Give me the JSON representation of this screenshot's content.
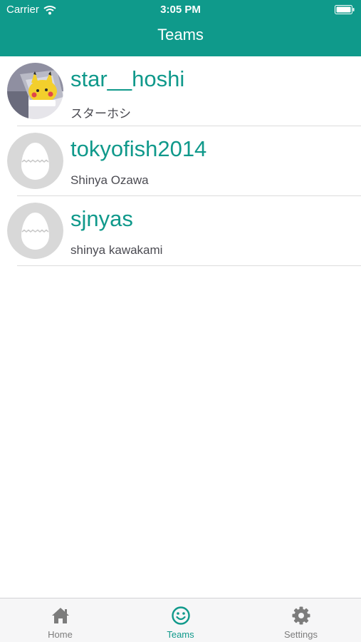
{
  "status_bar": {
    "carrier": "Carrier",
    "time": "3:05 PM"
  },
  "nav": {
    "title": "Teams"
  },
  "teams": [
    {
      "username": "star__hoshi",
      "display_name": "スターホシ",
      "avatar": "photo-avatar-icon"
    },
    {
      "username": "tokyofish2014",
      "display_name": "Shinya Ozawa",
      "avatar": "egg-placeholder-icon"
    },
    {
      "username": "sjnyas",
      "display_name": "shinya kawakami",
      "avatar": "egg-placeholder-icon"
    }
  ],
  "tabs": [
    {
      "label": "Home",
      "icon": "home-icon",
      "active": false
    },
    {
      "label": "Teams",
      "icon": "smiley-icon",
      "active": true
    },
    {
      "label": "Settings",
      "icon": "gear-icon",
      "active": false
    }
  ],
  "colors": {
    "accent": "#10998b",
    "header": "#0f9a8b",
    "inactive_tab": "#7c7c7c",
    "subtitle": "#4b4b52"
  }
}
